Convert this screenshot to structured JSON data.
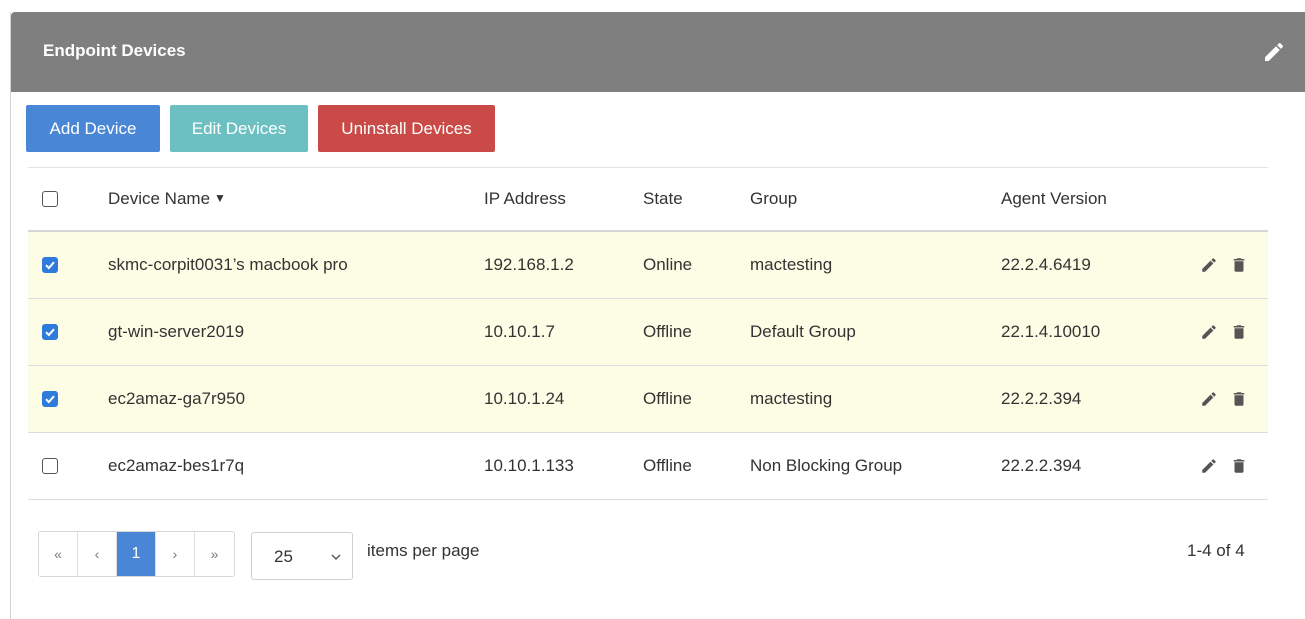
{
  "panel": {
    "title": "Endpoint Devices"
  },
  "toolbar": {
    "add_label": "Add Device",
    "edit_label": "Edit Devices",
    "uninstall_label": "Uninstall Devices"
  },
  "colors": {
    "header_bg": "#7f7f7f",
    "add": "#4a86d6",
    "edit": "#6cc0c2",
    "uninstall": "#c94a46",
    "selected_row": "#fdfde6",
    "checkbox_checked": "#2f7bdb"
  },
  "table": {
    "columns": [
      "Device Name",
      "IP Address",
      "State",
      "Group",
      "Agent Version"
    ],
    "sort_column": "Device Name",
    "rows": [
      {
        "checked": true,
        "name": "skmc-corpit0031’s macbook pro",
        "ip": "192.168.1.2",
        "state": "Online",
        "group": "mactesting",
        "agent": "22.2.4.6419"
      },
      {
        "checked": true,
        "name": "gt-win-server2019",
        "ip": "10.10.1.7",
        "state": "Offline",
        "group": "Default Group",
        "agent": "22.1.4.10010"
      },
      {
        "checked": true,
        "name": "ec2amaz-ga7r950",
        "ip": "10.10.1.24",
        "state": "Offline",
        "group": "mactesting",
        "agent": "22.2.2.394"
      },
      {
        "checked": false,
        "name": "ec2amaz-bes1r7q",
        "ip": "10.10.1.133",
        "state": "Offline",
        "group": "Non Blocking Group",
        "agent": "22.2.2.394"
      }
    ]
  },
  "pagination": {
    "first": "«",
    "prev": "‹",
    "current": "1",
    "next": "›",
    "last": "»",
    "page_size": "25",
    "per_page_label": "items per page",
    "range": "1-4 of 4"
  }
}
